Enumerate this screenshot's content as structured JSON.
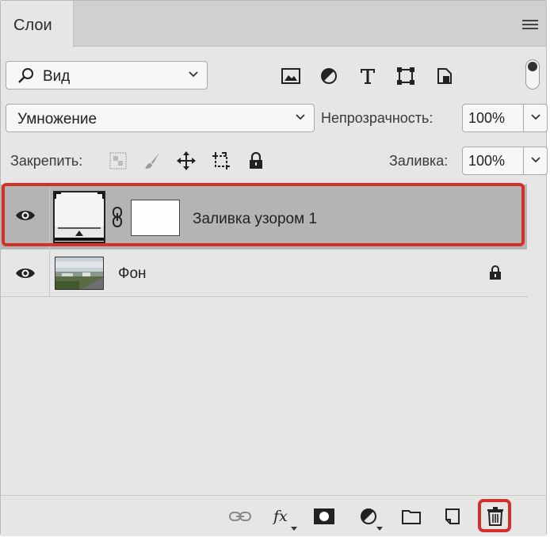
{
  "panel": {
    "tab_label": "Слои"
  },
  "filter": {
    "kind_label": "Вид"
  },
  "blend": {
    "mode_value": "Умножение",
    "opacity_label": "Непрозрачность:",
    "opacity_value": "100%"
  },
  "lock": {
    "label": "Закрепить:",
    "fill_label": "Заливка:",
    "fill_value": "100%"
  },
  "layers": [
    {
      "name": "Заливка узором 1",
      "visible": true,
      "selected": true,
      "kind": "pattern-fill"
    },
    {
      "name": "Фон",
      "visible": true,
      "selected": false,
      "locked": true,
      "kind": "background"
    }
  ],
  "colors": {
    "highlight": "#d4302a",
    "selected_row": "#b4b4b4",
    "panel_bg": "#e6e6e6"
  }
}
